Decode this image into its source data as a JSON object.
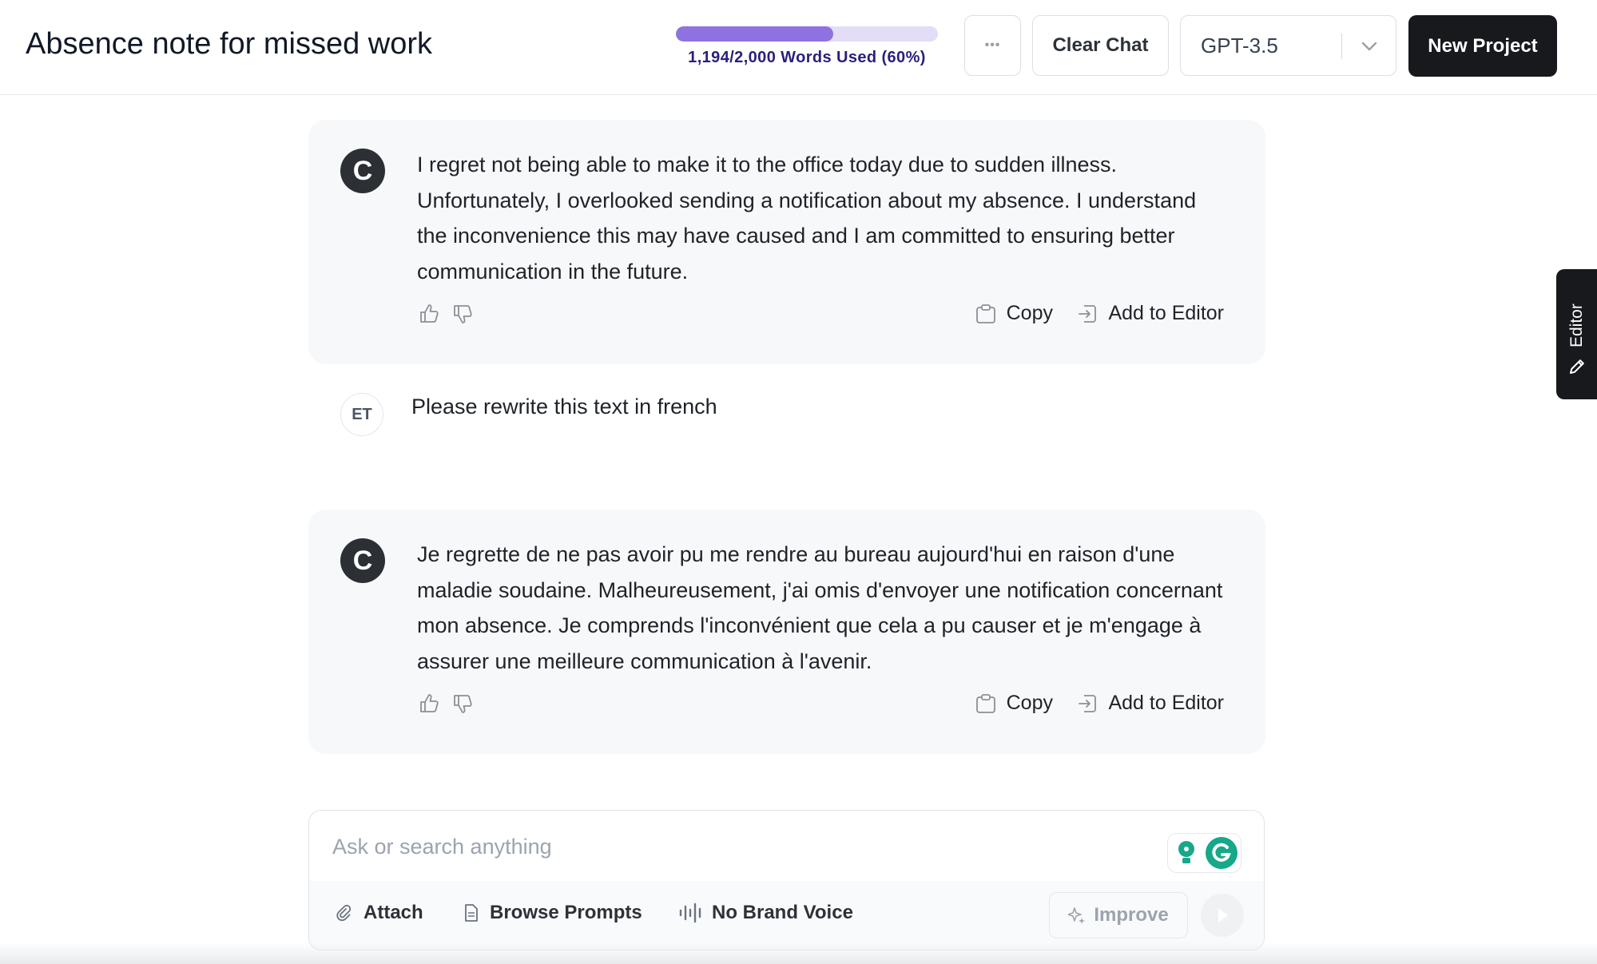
{
  "header": {
    "title": "Absence note for missed work",
    "usage": {
      "label": "1,194/2,000 Words Used (60%)",
      "used_fraction": 0.6
    },
    "more_label": "•••",
    "clear_chat_label": "Clear Chat",
    "model": {
      "selected": "GPT-3.5"
    },
    "new_project_label": "New Project"
  },
  "chat": {
    "messages": [
      {
        "role": "assistant",
        "avatar": "C",
        "text": "I regret not being able to make it to the office today due to sudden illness. Unfortunately, I overlooked sending a notification about my absence. I understand the inconvenience this may have caused and I am committed to ensuring better communication in the future.",
        "copy_label": "Copy",
        "add_label": "Add to Editor"
      },
      {
        "role": "user",
        "avatar": "ET",
        "text": "Please rewrite this text in french"
      },
      {
        "role": "assistant",
        "avatar": "C",
        "text": "Je regrette de ne pas avoir pu me rendre au bureau aujourd'hui en raison d'une maladie soudaine. Malheureusement, j'ai omis d'envoyer une notification concernant mon absence. Je comprends l'inconvénient que cela a pu causer et je m'engage à assurer une meilleure communication à l'avenir.",
        "copy_label": "Copy",
        "add_label": "Add to Editor"
      }
    ]
  },
  "editor_tab": {
    "label": "Editor"
  },
  "composer": {
    "placeholder": "Ask or search anything",
    "attach_label": "Attach",
    "browse_prompts_label": "Browse Prompts",
    "brand_voice_label": "No Brand Voice",
    "improve_label": "Improve"
  },
  "colors": {
    "accent": "#8e72df",
    "accent_track": "#e3ddf8",
    "usage_text": "#2a1f7c",
    "dark": "#17191c",
    "grammarly": "#15a889"
  },
  "icons": {
    "more": "more-dots-icon",
    "model_dropdown": "chevron-down-icon",
    "thumbs_up": "thumbs-up-icon",
    "thumbs_down": "thumbs-down-icon",
    "copy": "clipboard-icon",
    "add_to_editor": "add-to-editor-icon",
    "editor": "pencil-icon",
    "attach": "paperclip-icon",
    "prompts": "document-icon",
    "brand_voice": "sound-bars-icon",
    "improve": "sparkle-icon",
    "send": "send-icon",
    "grammarly": "grammarly-icon"
  }
}
